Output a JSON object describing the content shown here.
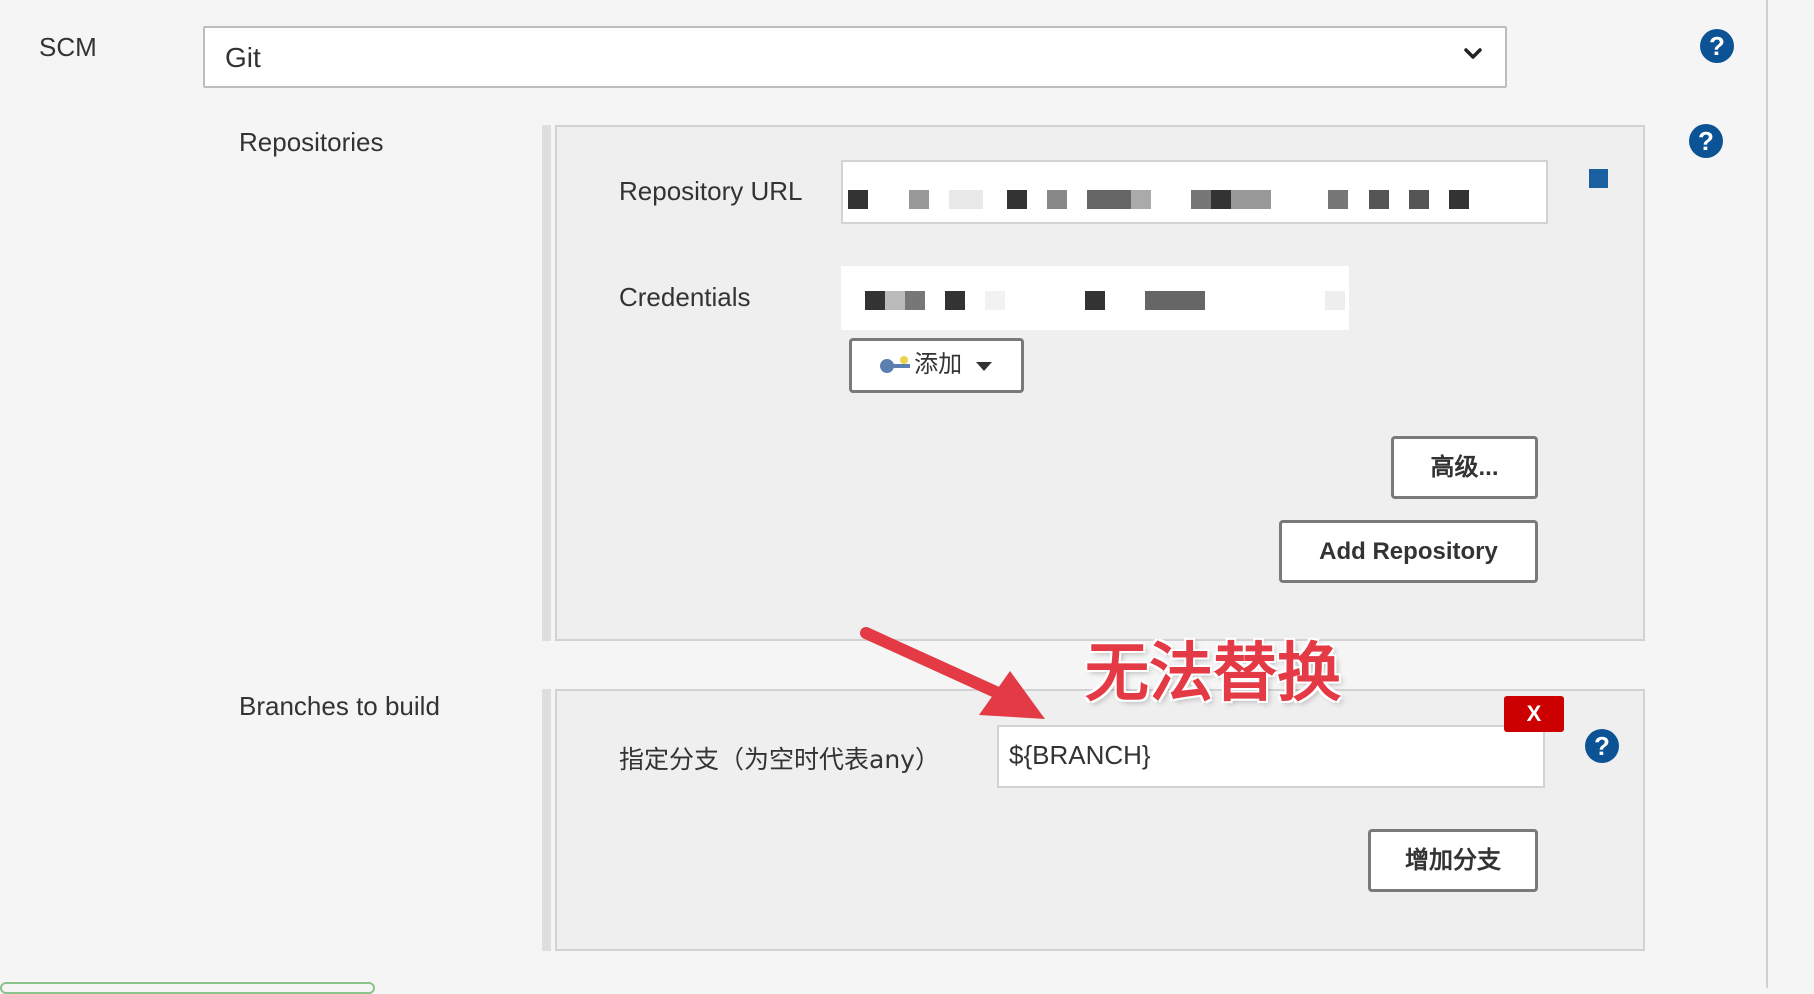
{
  "scm": {
    "label": "SCM",
    "selected": "Git"
  },
  "repositories": {
    "label": "Repositories",
    "repo_url_label": "Repository URL",
    "credentials_label": "Credentials",
    "add_credentials_label": "添加",
    "advanced_label": "高级...",
    "add_repository_label": "Add Repository"
  },
  "branches": {
    "label": "Branches to build",
    "specifier_label": "指定分支（为空时代表any）",
    "specifier_value": "${BRANCH}",
    "delete_label": "X",
    "add_branch_label": "增加分支"
  },
  "annotation": {
    "text": "无法替换",
    "color": "#e33a45"
  },
  "colors": {
    "help": "#0b5394",
    "delete": "#cc0000"
  },
  "icons": {
    "help": "help-icon",
    "key": "key-icon",
    "dropdown": "chevron-down-icon"
  }
}
